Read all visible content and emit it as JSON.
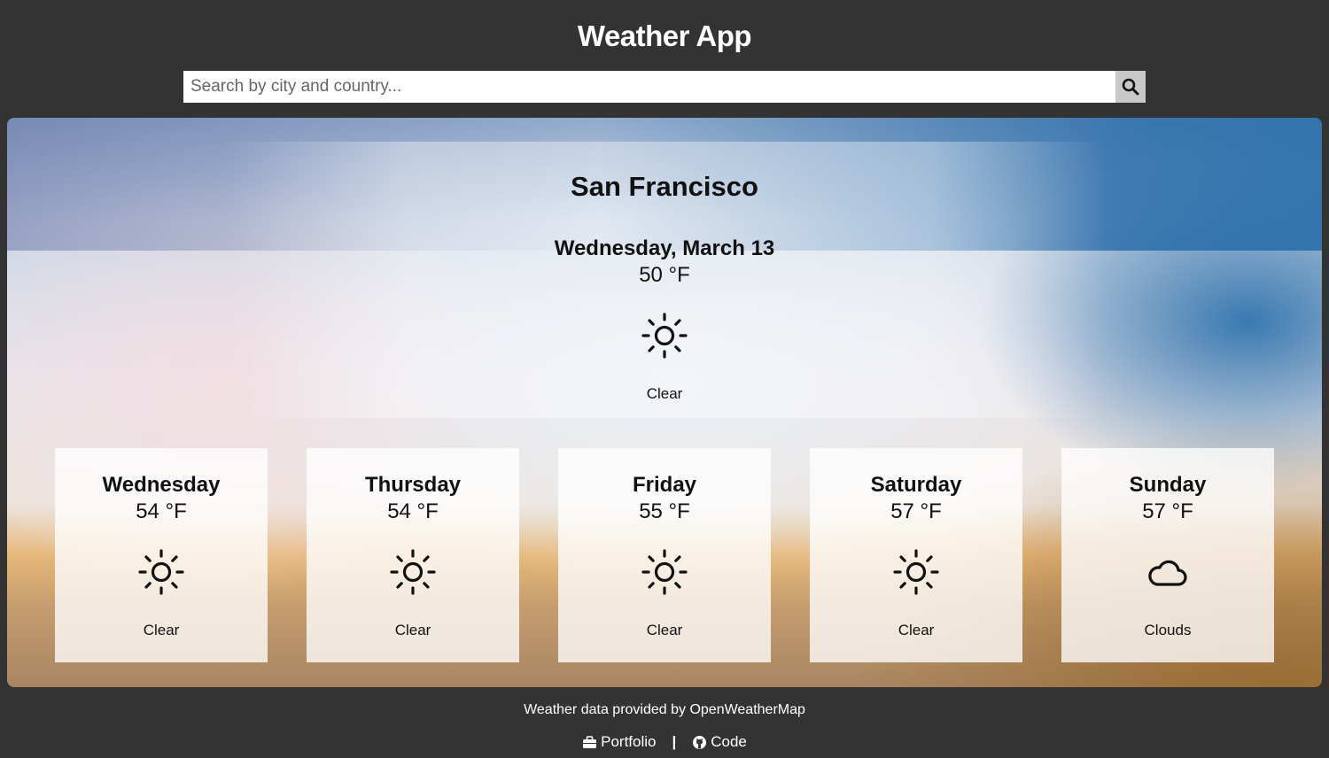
{
  "header": {
    "title": "Weather App"
  },
  "search": {
    "placeholder": "Search by city and country...",
    "value": "",
    "button_icon": "search-icon"
  },
  "today": {
    "city": "San Francisco",
    "date": "Wednesday, March 13",
    "temp": "50 °F",
    "icon": "sun-icon",
    "description": "Clear"
  },
  "forecast": [
    {
      "day": "Wednesday",
      "temp": "54 °F",
      "icon": "sun-icon",
      "description": "Clear"
    },
    {
      "day": "Thursday",
      "temp": "54 °F",
      "icon": "sun-icon",
      "description": "Clear"
    },
    {
      "day": "Friday",
      "temp": "55 °F",
      "icon": "sun-icon",
      "description": "Clear"
    },
    {
      "day": "Saturday",
      "temp": "57 °F",
      "icon": "sun-icon",
      "description": "Clear"
    },
    {
      "day": "Sunday",
      "temp": "57 °F",
      "icon": "cloud-icon",
      "description": "Clouds"
    }
  ],
  "footer": {
    "credit": "Weather data provided by OpenWeatherMap",
    "portfolio_label": "Portfolio",
    "portfolio_icon": "briefcase-icon",
    "separator": "|",
    "code_label": "Code",
    "code_icon": "github-icon"
  },
  "colors": {
    "background": "#333333",
    "text_dark": "#111111",
    "search_button": "#c8c8c8"
  }
}
